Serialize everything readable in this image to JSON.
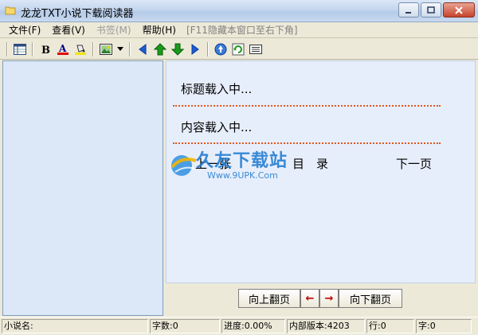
{
  "window": {
    "title": "龙龙TXT小说下载阅读器"
  },
  "menu": {
    "items": [
      {
        "label": "文件(F)",
        "enabled": true
      },
      {
        "label": "查看(V)",
        "enabled": true
      },
      {
        "label": "书签(M)",
        "enabled": false
      },
      {
        "label": "帮助(H)",
        "enabled": true
      }
    ],
    "hint": "[F11隐藏本窗口至右下角]"
  },
  "toolbar": {
    "icons": [
      "panel-icon",
      "bold-icon",
      "font-color-icon",
      "fill-color-icon",
      "image-icon",
      "dropdown-arrow-icon",
      "back-icon",
      "up-arrow-icon",
      "down-arrow-icon",
      "forward-icon",
      "globe-icon",
      "refresh-icon",
      "list-icon"
    ]
  },
  "content": {
    "title": "标题载入中...",
    "body": "内容载入中...",
    "prev_chapter": "上一张",
    "toc": "目　录",
    "next_page": "下一页"
  },
  "pager": {
    "prev_page": "向上翻页",
    "left_arrow": "←",
    "right_arrow": "→",
    "next_page": "向下翻页"
  },
  "watermark": {
    "brand": "久友下载站",
    "url": "Www.9UPK.Com"
  },
  "status": {
    "novel_name": "小说名:",
    "word_count": "字数:0",
    "progress": "进度:0.00%",
    "version": "内部版本:4203",
    "line": "行:0",
    "char": "字:0"
  },
  "colors": {
    "content_bg": "#e7eefb",
    "sidebar_bg": "#dce8f8",
    "separator": "#e2561d",
    "window_bg": "#ece9d8"
  }
}
